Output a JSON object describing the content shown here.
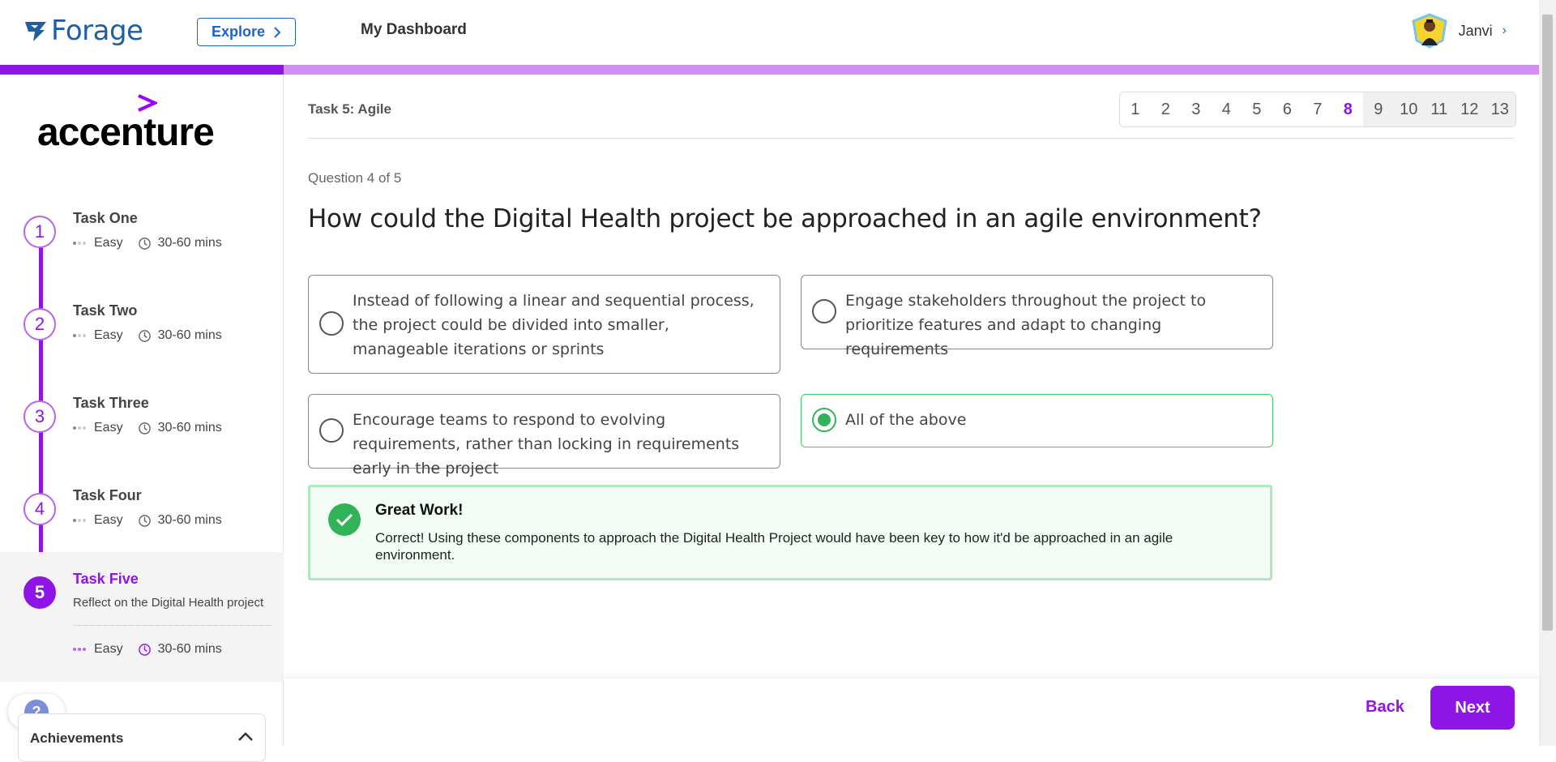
{
  "header": {
    "brand": "Forage",
    "explore_label": "Explore",
    "dashboard_label": "My Dashboard",
    "user_name": "Janvi"
  },
  "sidebar": {
    "company": "accenture",
    "tasks": [
      {
        "num": "1",
        "title": "Task One",
        "difficulty": "Easy",
        "duration": "30-60 mins"
      },
      {
        "num": "2",
        "title": "Task Two",
        "difficulty": "Easy",
        "duration": "30-60 mins"
      },
      {
        "num": "3",
        "title": "Task Three",
        "difficulty": "Easy",
        "duration": "30-60 mins"
      },
      {
        "num": "4",
        "title": "Task Four",
        "difficulty": "Easy",
        "duration": "30-60 mins"
      },
      {
        "num": "5",
        "title": "Task Five",
        "subtitle": "Reflect on the Digital Health project",
        "difficulty": "Easy",
        "duration": "30-60 mins"
      }
    ],
    "help_label": "?",
    "achievements_label": "Achievements"
  },
  "main": {
    "task_title": "Task 5: Agile",
    "pages": [
      "1",
      "2",
      "3",
      "4",
      "5",
      "6",
      "7",
      "8",
      "9",
      "10",
      "11",
      "12",
      "13"
    ],
    "current_page": "8",
    "question_counter": "Question 4 of 5",
    "question": "How could the Digital Health project be approached in an agile environment?",
    "options": [
      "Instead of following a linear and sequential process, the project could be divided into smaller, manageable iterations or sprints",
      "Engage stakeholders throughout the project to prioritize features and adapt to changing requirements",
      "Encourage teams to respond to evolving requirements, rather than locking in requirements early in the project",
      "All of the above"
    ],
    "selected_option": "All of the above",
    "feedback": {
      "title": "Great Work!",
      "body": "Correct! Using these components to approach the Digital Health Project would have been key to how it'd be approached in an agile environment."
    },
    "back_label": "Back",
    "next_label": "Next"
  },
  "colors": {
    "accent": "#8f14e6",
    "progress_light": "#d18ef5",
    "success": "#31b458",
    "brand_blue": "#1f5fa0"
  }
}
